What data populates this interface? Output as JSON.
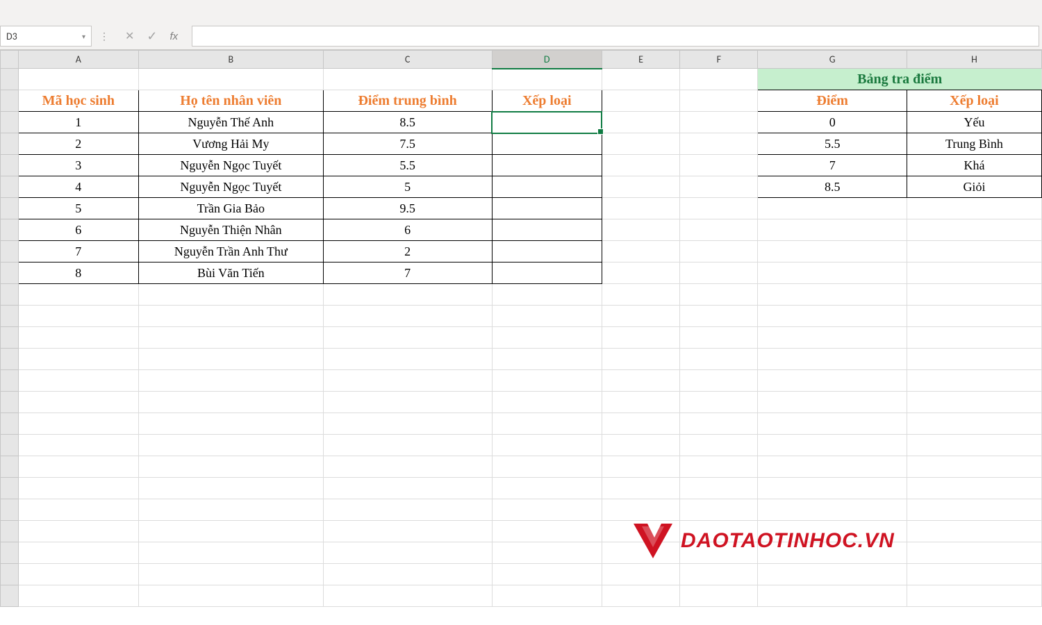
{
  "formula_bar": {
    "name_box_value": "D3",
    "fx_label": "fx",
    "formula_value": ""
  },
  "columns": [
    "A",
    "B",
    "C",
    "D",
    "E",
    "F",
    "G",
    "H"
  ],
  "active_column": "D",
  "main_table": {
    "headers": {
      "ma_hoc_sinh": "Mã học sinh",
      "ho_ten": "Họ tên nhân viên",
      "diem_tb": "Điểm trung bình",
      "xep_loai": "Xếp loại"
    },
    "rows": [
      {
        "id": "1",
        "name": "Nguyễn Thế Anh",
        "score": "8.5",
        "rank": ""
      },
      {
        "id": "2",
        "name": "Vương Hải My",
        "score": "7.5",
        "rank": ""
      },
      {
        "id": "3",
        "name": "Nguyễn Ngọc Tuyết",
        "score": "5.5",
        "rank": ""
      },
      {
        "id": "4",
        "name": "Nguyễn Ngọc Tuyết",
        "score": "5",
        "rank": ""
      },
      {
        "id": "5",
        "name": "Trần Gia Bảo",
        "score": "9.5",
        "rank": ""
      },
      {
        "id": "6",
        "name": "Nguyễn Thiện Nhân",
        "score": "6",
        "rank": ""
      },
      {
        "id": "7",
        "name": "Nguyễn Trần Anh Thư",
        "score": "2",
        "rank": ""
      },
      {
        "id": "8",
        "name": "Bùi Văn Tiến",
        "score": "7",
        "rank": ""
      }
    ]
  },
  "lookup_table": {
    "title": "Bảng tra điểm",
    "headers": {
      "diem": "Điểm",
      "xep_loai": "Xếp loại"
    },
    "rows": [
      {
        "score": "0",
        "rank": "Yếu"
      },
      {
        "score": "5.5",
        "rank": "Trung Bình"
      },
      {
        "score": "7",
        "rank": "Khá"
      },
      {
        "score": "8.5",
        "rank": "Giỏi"
      }
    ]
  },
  "watermark_text": "DAOTAOTINHOC.VN"
}
